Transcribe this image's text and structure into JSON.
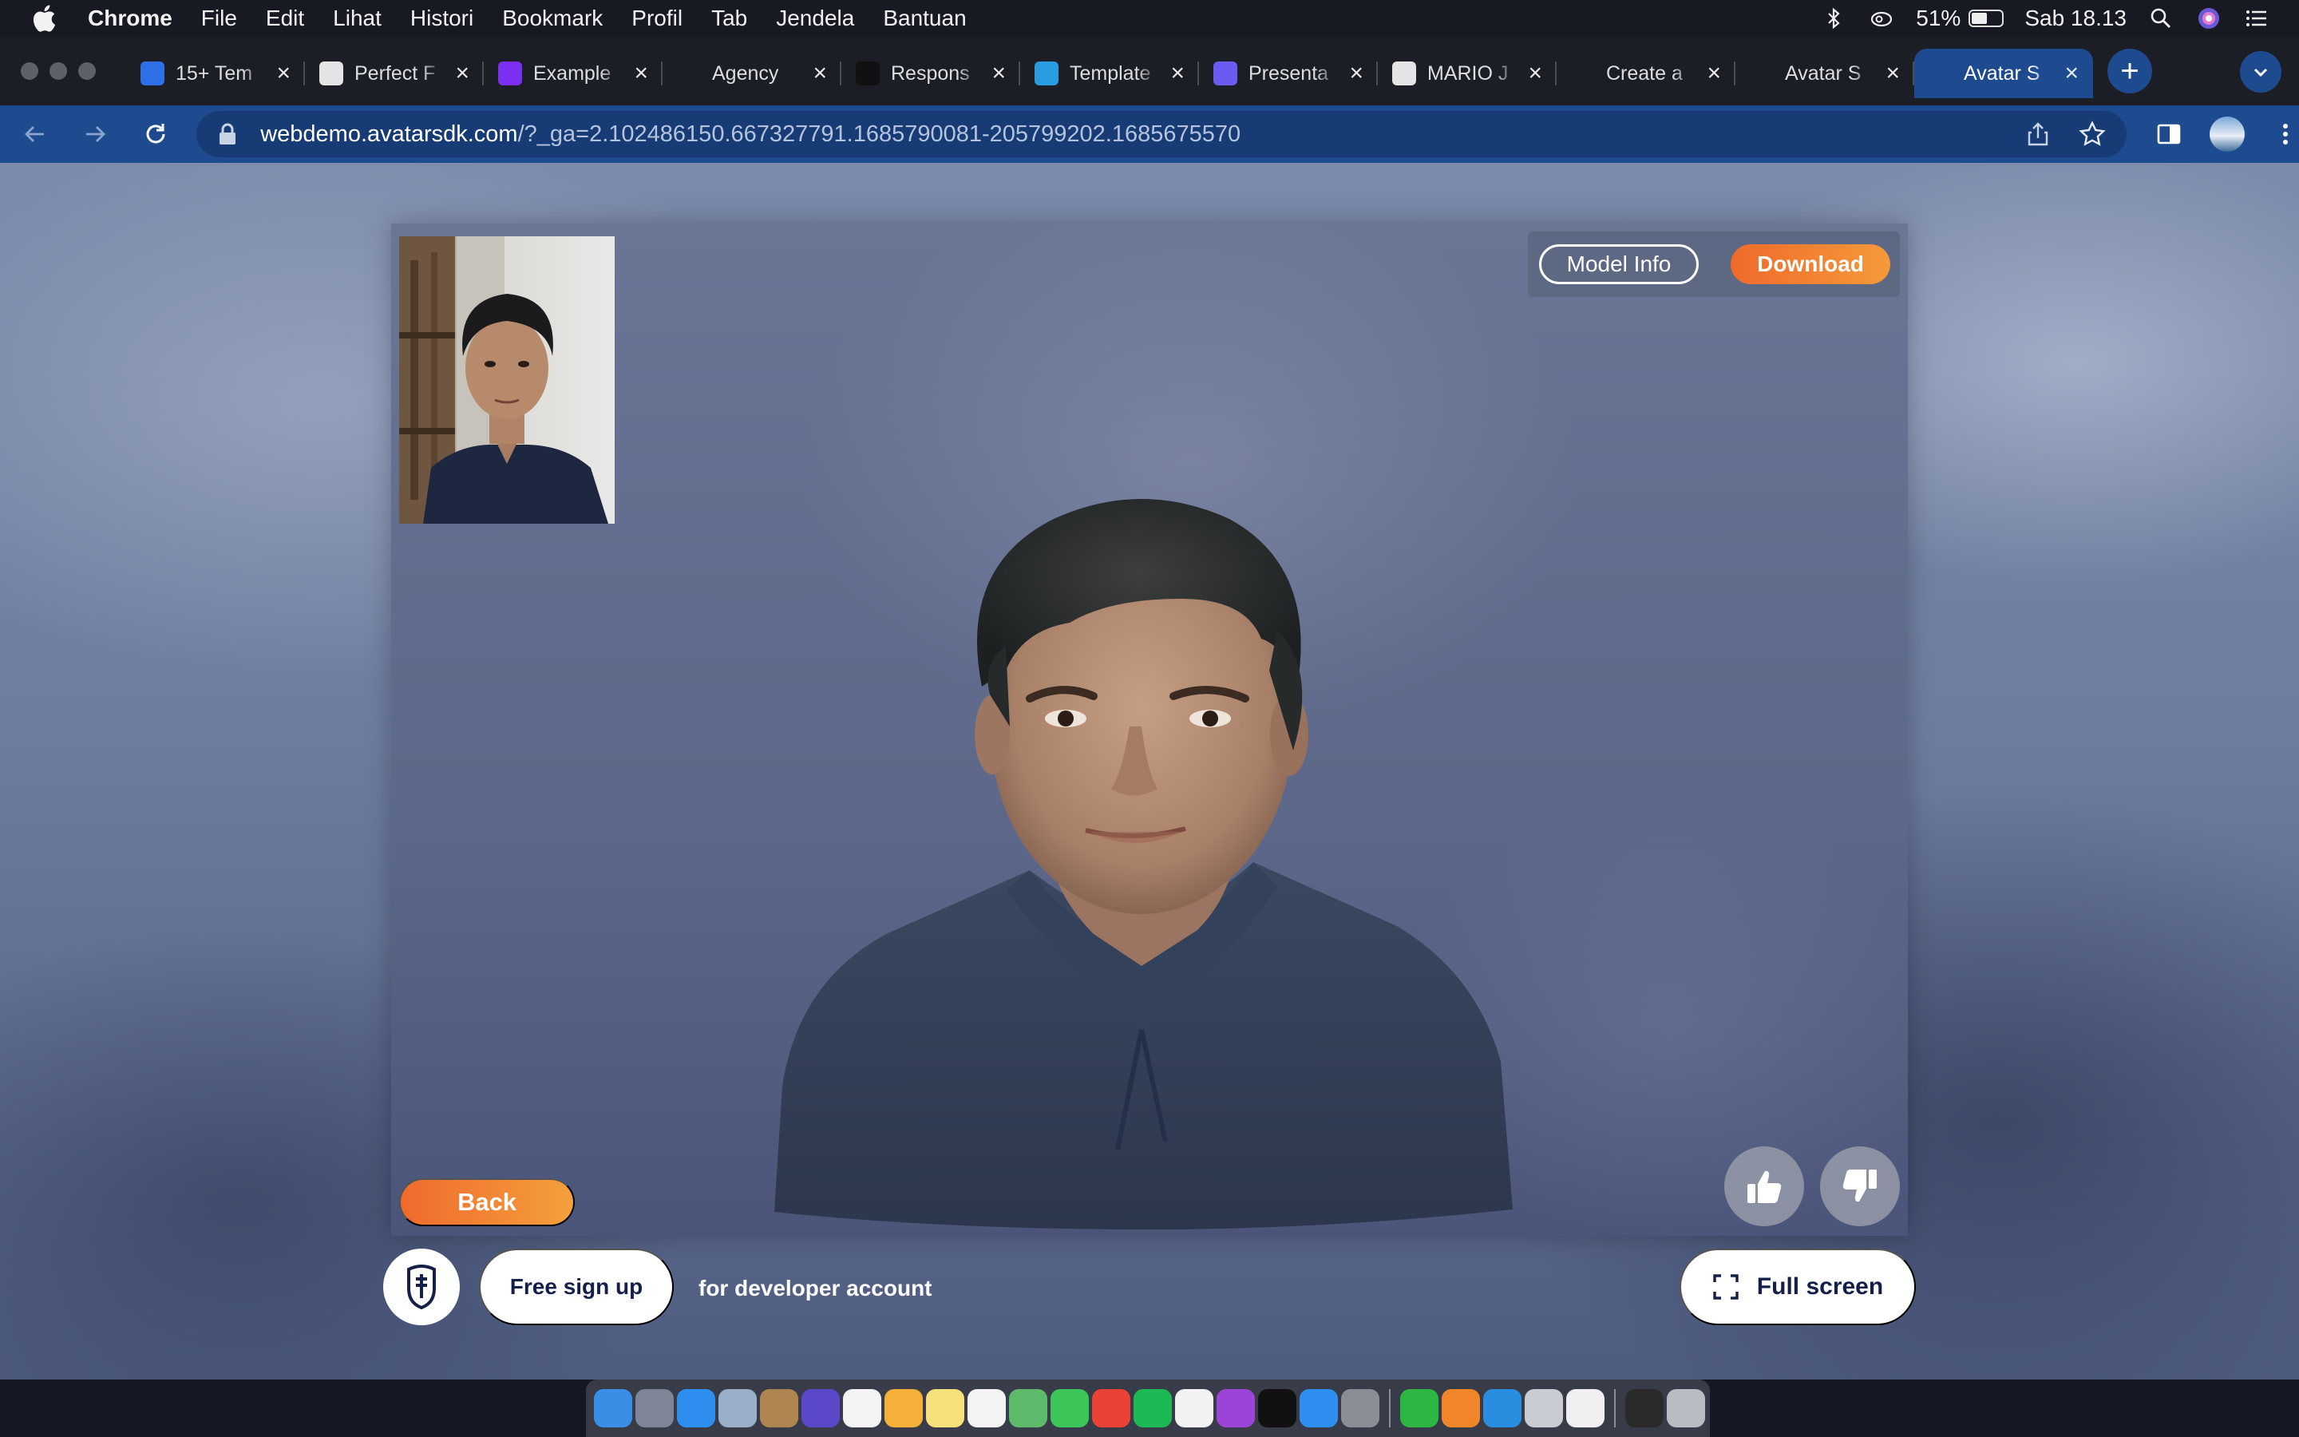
{
  "menubar": {
    "app_name": "Chrome",
    "items": [
      "File",
      "Edit",
      "Lihat",
      "Histori",
      "Bookmark",
      "Profil",
      "Tab",
      "Jendela",
      "Bantuan"
    ],
    "battery_percent": "51%",
    "battery_level": 0.51,
    "clock": "Sab 18.13"
  },
  "tabs": [
    {
      "title": "15+ Tem",
      "favicon": "wave-logo-icon",
      "color": "#2f6fe8"
    },
    {
      "title": "Perfect F",
      "favicon": "wordpress-icon",
      "color": "#e4e4e4"
    },
    {
      "title": "Example",
      "favicon": "bootstrap-icon",
      "color": "#7b2ff0"
    },
    {
      "title": "Agency",
      "favicon": "globe-icon",
      "color": "#1c1e26"
    },
    {
      "title": "Respons",
      "favicon": "angular-icon",
      "color": "#111111"
    },
    {
      "title": "Template",
      "favicon": "canva-icon",
      "color": "#2a9de0"
    },
    {
      "title": "Presenta",
      "favicon": "pitch-icon",
      "color": "#6a5cf0"
    },
    {
      "title": "MARIO J",
      "favicon": "globe-icon",
      "color": "#e4e4e4"
    },
    {
      "title": "Create a",
      "favicon": "avatarsdk-icon",
      "color": "#1c1e26"
    },
    {
      "title": "Avatar S",
      "favicon": "avatarsdk-icon",
      "color": "#1c1e26"
    },
    {
      "title": "Avatar S",
      "favicon": "avatarsdk-icon",
      "color": "#1e4b8f",
      "active": true
    }
  ],
  "toolbar": {
    "url_host": "webdemo.avatarsdk.com",
    "url_path": "/?_ga=2.102486150.667327791.1685790081-205799202.1685675570"
  },
  "page": {
    "model_info_label": "Model Info",
    "download_label": "Download",
    "back_label": "Back",
    "signup_label": "Free sign up",
    "developer_text": "for developer account",
    "fullscreen_label": "Full screen",
    "accent_color": "#f06a2b",
    "navy_color": "#15204a"
  },
  "dock": {
    "apps": [
      {
        "name": "finder-icon",
        "color": "#3a8ee6"
      },
      {
        "name": "launchpad-icon",
        "color": "#7d8596"
      },
      {
        "name": "safari-icon",
        "color": "#2f8ff0"
      },
      {
        "name": "preview-icon",
        "color": "#9bb0c8"
      },
      {
        "name": "notes-brown-icon",
        "color": "#b08450"
      },
      {
        "name": "siri-icon",
        "color": "#5a48c9"
      },
      {
        "name": "calendar-icon",
        "color": "#f4f4f4"
      },
      {
        "name": "photos-icon",
        "color": "#f5b03a"
      },
      {
        "name": "notes-icon",
        "color": "#f5e07a"
      },
      {
        "name": "reminders-icon",
        "color": "#f3f3f3"
      },
      {
        "name": "maps-icon",
        "color": "#5cba6a"
      },
      {
        "name": "facetime-icon",
        "color": "#3cc65a"
      },
      {
        "name": "chrome-icon",
        "color": "#e84335"
      },
      {
        "name": "spotify-icon",
        "color": "#1db954"
      },
      {
        "name": "music-icon",
        "color": "#f2f2f2"
      },
      {
        "name": "podcasts-icon",
        "color": "#9b44d8"
      },
      {
        "name": "tv-icon",
        "color": "#111111"
      },
      {
        "name": "app-store-icon",
        "color": "#2f8ff0"
      },
      {
        "name": "system-settings-icon",
        "color": "#8a8d94"
      },
      {
        "name": "whatsapp-icon",
        "color": "#2bb741"
      },
      {
        "name": "blender-icon",
        "color": "#f0852a"
      },
      {
        "name": "vscode-icon",
        "color": "#2a8ee0"
      },
      {
        "name": "utility-icon",
        "color": "#c9ccd2"
      },
      {
        "name": "textedit-icon",
        "color": "#f0f0f0"
      },
      {
        "name": "terminal-icon",
        "color": "#2a2a2a"
      },
      {
        "name": "trash-icon",
        "color": "#b9bcc3"
      }
    ]
  }
}
